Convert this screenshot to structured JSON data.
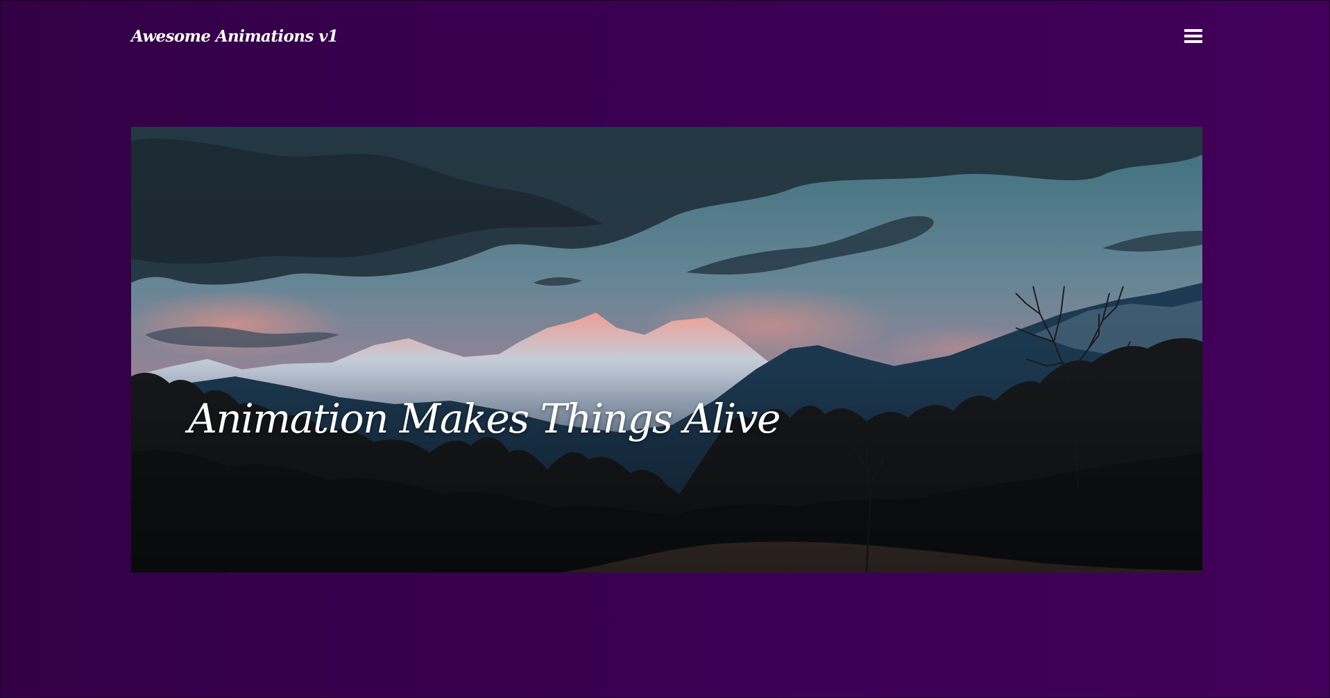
{
  "site": {
    "brand": "Awesome Animations v1"
  },
  "nav": {
    "menu_icon": "hamburger-menu-icon"
  },
  "hero": {
    "title": "Animation Makes Things Alive",
    "image": "mountain-sunset-landscape"
  },
  "colors": {
    "background_left": "#330045",
    "background_right": "#42005a",
    "text": "#ffffff"
  }
}
